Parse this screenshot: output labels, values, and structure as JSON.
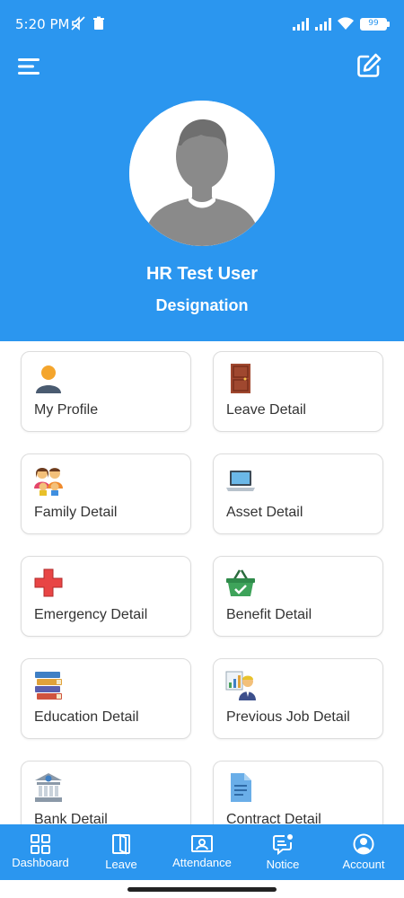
{
  "status_bar": {
    "time": "5:20 PM",
    "battery": "99"
  },
  "header": {
    "menu_icon": "hamburger-menu-icon",
    "edit_icon": "edit-icon",
    "user_name": "HR Test User",
    "designation": "Designation",
    "bg_color": "#2b96ef"
  },
  "tiles": [
    {
      "label": "My Profile",
      "icon": "person-icon"
    },
    {
      "label": "Leave Detail",
      "icon": "door-icon"
    },
    {
      "label": "Family Detail",
      "icon": "family-icon"
    },
    {
      "label": "Asset Detail",
      "icon": "laptop-icon"
    },
    {
      "label": "Emergency Detail",
      "icon": "red-cross-icon"
    },
    {
      "label": "Benefit Detail",
      "icon": "basket-icon"
    },
    {
      "label": "Education Detail",
      "icon": "books-icon"
    },
    {
      "label": "Previous Job Detail",
      "icon": "presenter-icon"
    },
    {
      "label": "Bank Detail",
      "icon": "bank-icon"
    },
    {
      "label": "Contract Detail",
      "icon": "document-icon"
    }
  ],
  "bottom_nav": [
    {
      "label": "Dashboard",
      "icon": "dashboard-icon"
    },
    {
      "label": "Leave",
      "icon": "leave-door-icon"
    },
    {
      "label": "Attendance",
      "icon": "attendance-icon"
    },
    {
      "label": "Notice",
      "icon": "notice-icon"
    },
    {
      "label": "Account",
      "icon": "account-icon"
    }
  ]
}
